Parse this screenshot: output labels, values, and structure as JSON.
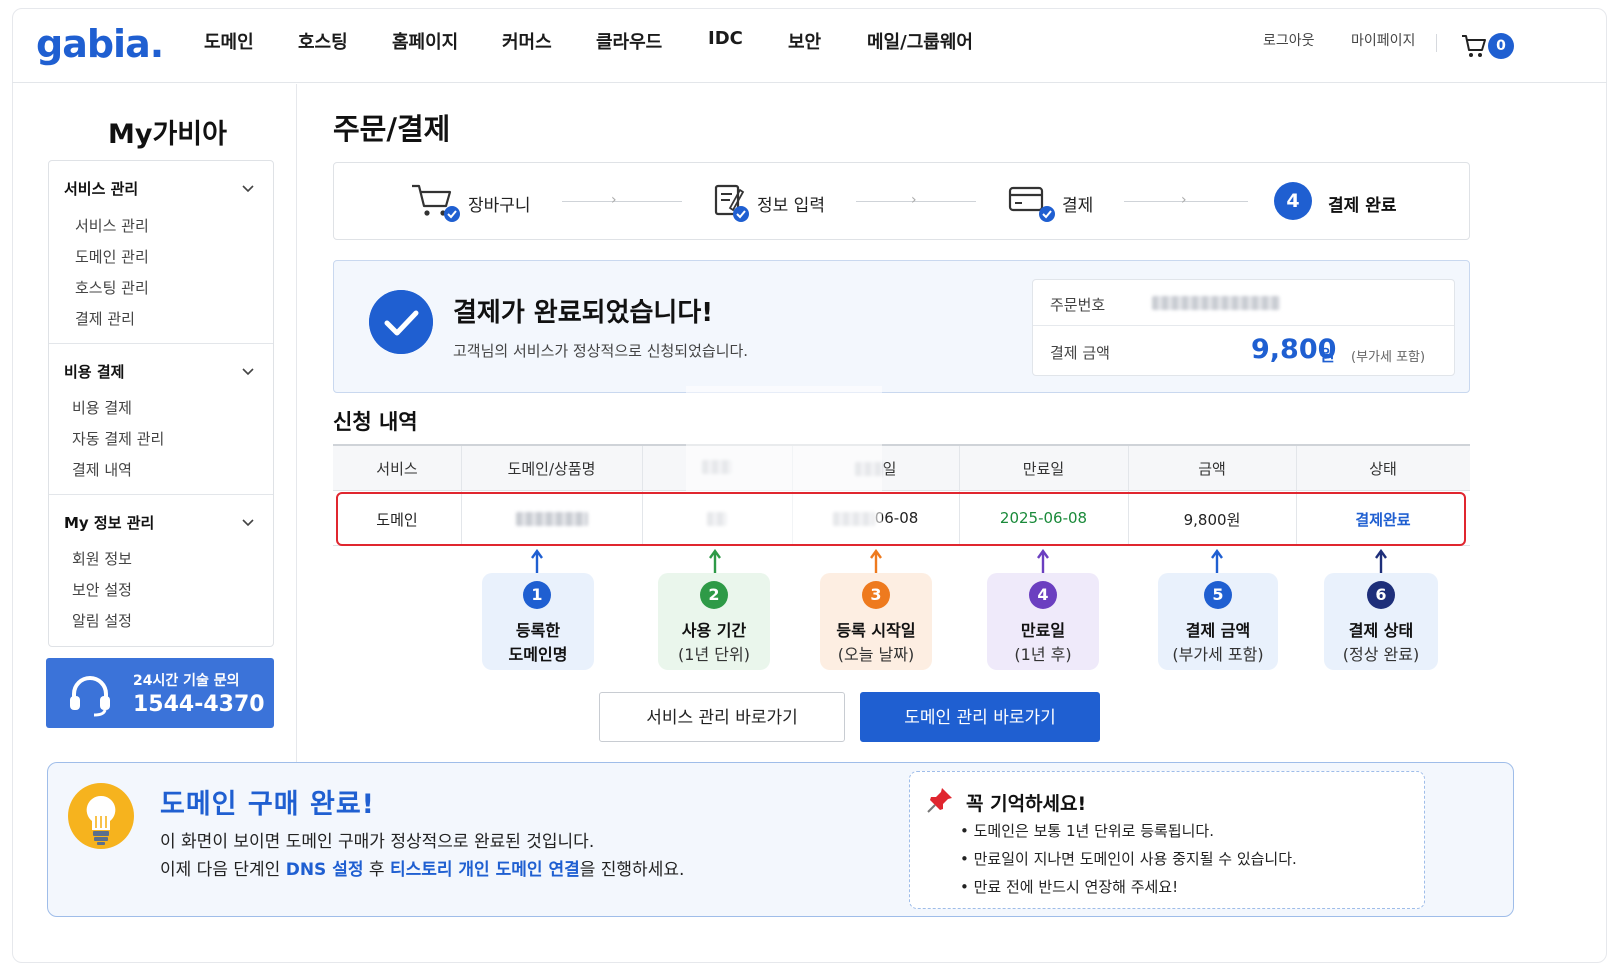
{
  "header": {
    "logo": "gabia.",
    "nav": [
      "도메인",
      "호스팅",
      "홈페이지",
      "커머스",
      "클라우드",
      "IDC",
      "보안",
      "메일/그룹웨어"
    ],
    "logout": "로그아웃",
    "mypage": "마이페이지",
    "cart_count": "0"
  },
  "sidebar": {
    "title": "My가비아",
    "groups": [
      {
        "title": "서비스 관리",
        "items": [
          "서비스 관리",
          "도메인 관리",
          "호스팅 관리",
          "결제 관리"
        ]
      },
      {
        "title": "비용 결제",
        "items": [
          "비용 결제",
          "자동 결제 관리",
          "결제 내역"
        ]
      },
      {
        "title": "My 정보 관리",
        "items": [
          "회원 정보",
          "보안 설정",
          "알림 설정"
        ]
      }
    ],
    "support_label": "24시간 기술 문의",
    "support_number": "1544-4370"
  },
  "main": {
    "title": "주문/결제",
    "steps": [
      "장바구니",
      "정보 입력",
      "결제",
      "결제 완료"
    ],
    "current_step": "4",
    "done_title": "결제가 완료되었습니다!",
    "done_sub": "고객님의 서비스가 정상적으로 신청되었습니다.",
    "order_no_label": "주문번호",
    "amount_label": "결제 금액",
    "amount": "9,800",
    "amount_unit": "원",
    "amount_vat": "(부가세 포함)",
    "section_title": "신청 내역",
    "table": {
      "headers": [
        "서비스",
        "도메인/상품명",
        "기간",
        "등록일",
        "만료일",
        "금액",
        "상태"
      ],
      "row": {
        "service": "도메인",
        "start_date_suffix": "06-08",
        "expire": "2025-06-08",
        "amount": "9,800원",
        "status": "결제완료"
      }
    },
    "callouts": [
      {
        "num": "1",
        "line1": "등록한",
        "line2": "도메인명"
      },
      {
        "num": "2",
        "line1": "사용 기간",
        "line2": "(1년 단위)"
      },
      {
        "num": "3",
        "line1": "등록 시작일",
        "line2": "(오늘 날짜)"
      },
      {
        "num": "4",
        "line1": "만료일",
        "line2": "(1년 후)"
      },
      {
        "num": "5",
        "line1": "결제 금액",
        "line2": "(부가세 포함)"
      },
      {
        "num": "6",
        "line1": "결제 상태",
        "line2": "(정상 완료)"
      }
    ],
    "btn_service": "서비스 관리 바로가기",
    "btn_domain": "도메인 관리 바로가기"
  },
  "bottom": {
    "title": "도메인 구매 완료!",
    "line1": "이 화면이 보이면 도메인 구매가 정상적으로 완료된 것입니다.",
    "line2_pre": "이제 다음 단계인 ",
    "line2_link1": "DNS 설정",
    "line2_mid": " 후 ",
    "line2_link2": "티스토리 개인 도메인 연결",
    "line2_post": "을 진행하세요.",
    "memo_title": "꼭 기억하세요!",
    "memo_items": [
      "• 도메인은 보통 1년 단위로 등록됩니다.",
      "• 만료일이 지나면 도메인이 사용 중지될 수 있습니다.",
      "• 만료 전에 반드시 연장해 주세요!"
    ]
  },
  "colors": {
    "brand": "#1f5fd1",
    "highlight": "#e0262f",
    "expire_green": "#1a8a3a"
  }
}
